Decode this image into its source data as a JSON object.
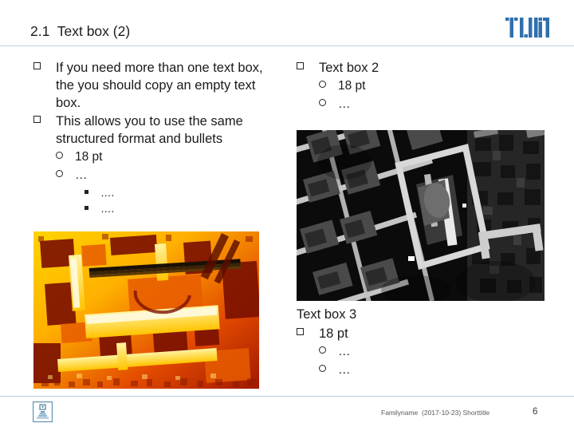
{
  "header": {
    "title": "2.1  Text box (2)",
    "logo_icon": "tum-logo",
    "rule_color": "#b9cfd8",
    "logo_color": "#3070ad"
  },
  "textbox_1": {
    "name": "Text box 1",
    "lines": [
      {
        "level": 0,
        "bullet": "square-hollow",
        "text": "If you need more than one text box, the you should copy an empty text box."
      },
      {
        "level": 0,
        "bullet": "square-hollow",
        "text": "This allows you to use the same structured format and bullets"
      },
      {
        "level": 1,
        "bullet": "circle-hollow",
        "text": "18 pt"
      },
      {
        "level": 1,
        "bullet": "circle-hollow",
        "text": "…"
      },
      {
        "level": 2,
        "bullet": "square-filled",
        "text": "…."
      },
      {
        "level": 2,
        "bullet": "square-filled",
        "text": "…."
      }
    ]
  },
  "textbox_2": {
    "name": "Text box 2",
    "lines": [
      {
        "level": 0,
        "bullet": "square-hollow",
        "text": "Text box 2"
      },
      {
        "level": 1,
        "bullet": "circle-hollow",
        "text": "18 pt"
      },
      {
        "level": 1,
        "bullet": "circle-hollow",
        "text": "…"
      }
    ]
  },
  "textbox_3": {
    "name": "Text box 3",
    "heading": "Text box 3",
    "lines": [
      {
        "level": 0,
        "bullet": "square-hollow",
        "text": "18 pt"
      },
      {
        "level": 1,
        "bullet": "circle-hollow",
        "text": "…"
      },
      {
        "level": 1,
        "bullet": "circle-hollow",
        "text": "…"
      }
    ]
  },
  "images": {
    "thermal": {
      "name": "thermal-aerial-image",
      "description": "False-colour thermal aerial photograph of a building complex"
    },
    "grayscale": {
      "name": "grayscale-aerial-image",
      "description": "Grayscale aerial photograph of a city block"
    }
  },
  "footer": {
    "logo_icon": "institution-crest-icon",
    "text": "Familyname  (2017-10-23) Shorttitle",
    "page_number": "6",
    "rule_color": "#b9cfd8"
  }
}
